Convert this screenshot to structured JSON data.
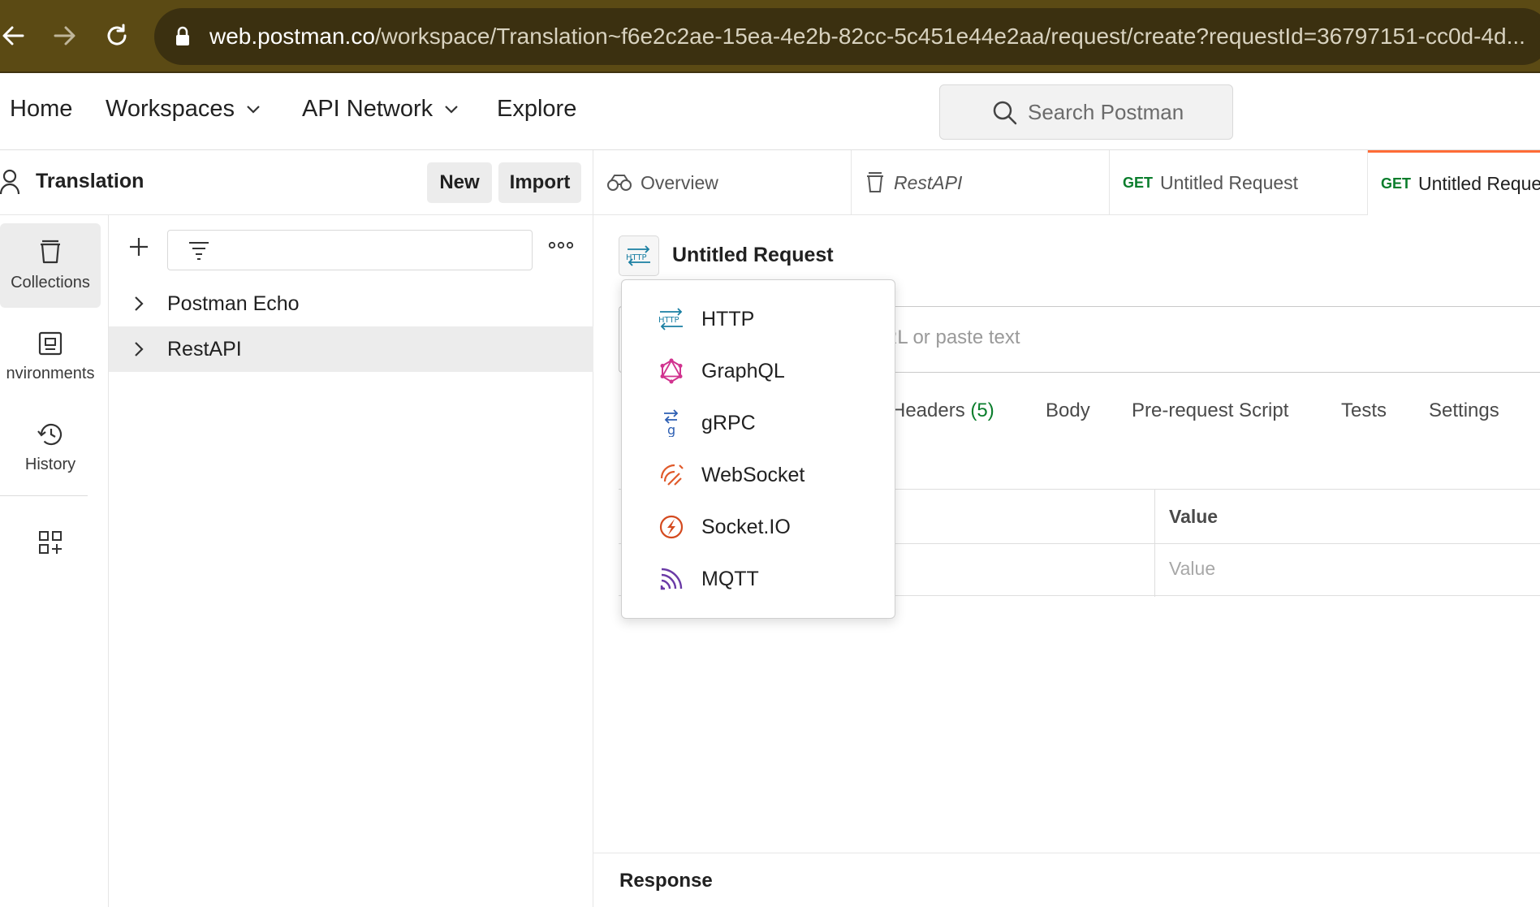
{
  "browser": {
    "url_host": "web.postman.co",
    "url_path": "/workspace/Translation~f6e2c2ae-15ea-4e2b-82cc-5c451e44e2aa/request/create?requestId=36797151-cc0d-4d..."
  },
  "header": {
    "nav": [
      "Home",
      "Workspaces",
      "API Network",
      "Explore"
    ],
    "search_placeholder": "Search Postman"
  },
  "workspace": {
    "title": "Translation",
    "new_label": "New",
    "import_label": "Import"
  },
  "rail": {
    "items": [
      {
        "label": "Collections",
        "icon": "collections-icon"
      },
      {
        "label": "nvironments",
        "icon": "environments-icon"
      },
      {
        "label": "History",
        "icon": "history-icon"
      }
    ],
    "extra_icon": "configure-workbench-icon"
  },
  "collections": [
    {
      "name": "Postman Echo"
    },
    {
      "name": "RestAPI"
    }
  ],
  "tabs": [
    {
      "label": "Overview",
      "icon": "overview-icon"
    },
    {
      "label": "RestAPI",
      "icon": "collection-icon"
    },
    {
      "method": "GET",
      "label": "Untitled Request"
    },
    {
      "method": "GET",
      "label": "Untitled Reque"
    }
  ],
  "request": {
    "title": "Untitled Request",
    "url_placeholder": "RL or paste text",
    "tabs": [
      {
        "label": "Headers",
        "count": "(5)"
      },
      {
        "label": "Body"
      },
      {
        "label": "Pre-request Script"
      },
      {
        "label": "Tests"
      },
      {
        "label": "Settings"
      }
    ],
    "table_value_header": "Value",
    "table_value_placeholder": "Value",
    "response_label": "Response"
  },
  "dropdown": {
    "items": [
      {
        "label": "HTTP",
        "icon": "http-icon",
        "color": "#1a7fa3"
      },
      {
        "label": "GraphQL",
        "icon": "graphql-icon",
        "color": "#d1338f"
      },
      {
        "label": "gRPC",
        "icon": "grpc-icon",
        "color": "#2d5fb3"
      },
      {
        "label": "WebSocket",
        "icon": "websocket-icon",
        "color": "#e05a2b"
      },
      {
        "label": "Socket.IO",
        "icon": "socketio-icon",
        "color": "#d44a1f"
      },
      {
        "label": "MQTT",
        "icon": "mqtt-icon",
        "color": "#6a3aa6"
      }
    ]
  },
  "colors": {
    "accent": "#ff6c37",
    "method_get": "#0a7d2c",
    "browser_bar": "#5b4a14"
  }
}
